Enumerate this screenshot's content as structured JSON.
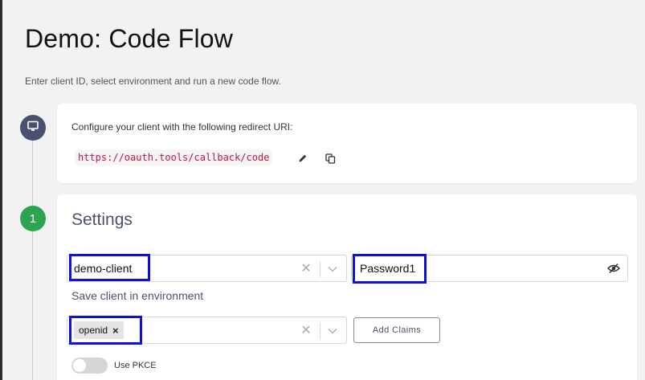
{
  "header": {
    "title": "Demo: Code Flow",
    "subtitle": "Enter client ID, select environment and run a new code flow."
  },
  "timeline": {
    "steps": [
      {
        "icon": "monitor-icon"
      },
      {
        "number": "1",
        "color": "#2ea44f"
      }
    ]
  },
  "redirect": {
    "label": "Configure your client with the following redirect URI:",
    "uri": "https://oauth.tools/callback/code",
    "icons": [
      "edit-pencil-icon",
      "copy-icon"
    ]
  },
  "settings": {
    "title": "Settings",
    "client_select": {
      "value": "demo-client"
    },
    "client_secret": {
      "value": "Password1"
    },
    "save_link": "Save client in environment",
    "scopes": {
      "chips": [
        "openid"
      ]
    },
    "add_claims_label": "Add Claims",
    "pkce": {
      "label": "Use PKCE",
      "enabled": false
    }
  },
  "colors": {
    "accent": "#4a5170",
    "step_green": "#2ea44f",
    "uri_text": "#c0163f",
    "highlight": "#1010d8"
  }
}
